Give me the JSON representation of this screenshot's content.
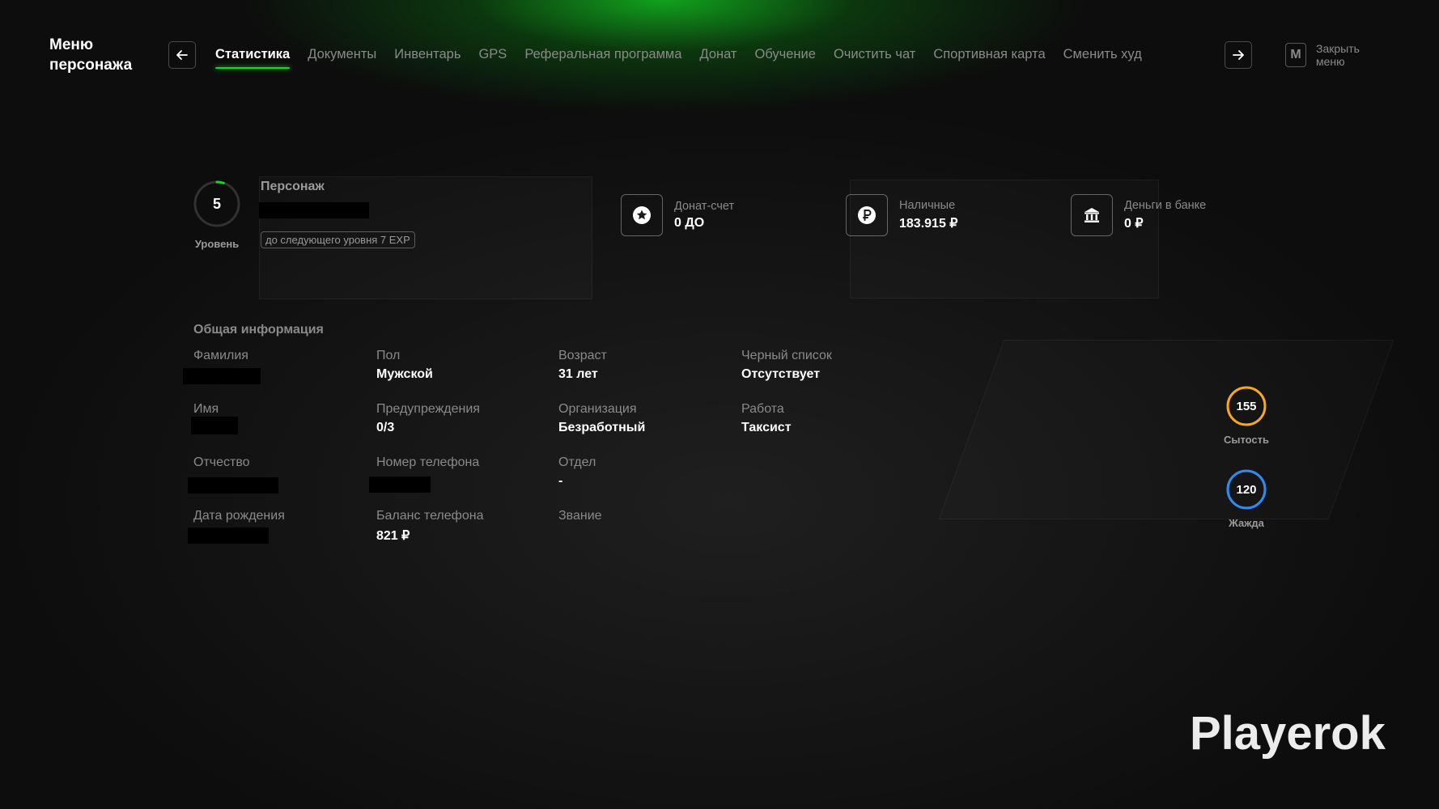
{
  "header": {
    "title_line1": "Меню",
    "title_line2": "персонажа",
    "tabs": [
      {
        "label": "Статистика",
        "active": true
      },
      {
        "label": "Документы"
      },
      {
        "label": "Инвентарь"
      },
      {
        "label": "GPS"
      },
      {
        "label": "Реферальная программа"
      },
      {
        "label": "Донат"
      },
      {
        "label": "Обучение"
      },
      {
        "label": "Очистить чат"
      },
      {
        "label": "Спортивная карта"
      },
      {
        "label": "Сменить худ"
      }
    ],
    "close_key": "M",
    "close_label": "Закрыть меню",
    "accent_color": "#1dd12e"
  },
  "character": {
    "level": "5",
    "level_label": "Уровень",
    "level_progress": 0.05,
    "label": "Персонаж",
    "exp_hint": "до следующего уровня 7 EXP"
  },
  "stats": {
    "donate_label": "Донат-счет",
    "donate_value": "0 ДО",
    "cash_label": "Наличные",
    "cash_value": "183.915 ₽",
    "bank_label": "Деньги в банке",
    "bank_value": "0 ₽",
    "icons": [
      "star-circle-icon",
      "ruble-circle-icon",
      "bank-icon"
    ]
  },
  "info": {
    "title": "Общая информация",
    "surname_label": "Фамилия",
    "name_label": "Имя",
    "patronymic_label": "Отчество",
    "birth_label": "Дата рождения",
    "gender_label": "Пол",
    "gender_value": "Мужской",
    "warnings_label": "Предупреждения",
    "warnings_value": "0/3",
    "phone_label": "Номер телефона",
    "phone_balance_label": "Баланс телефона",
    "phone_balance_value": "821 ₽",
    "age_label": "Возраст",
    "age_value": "31 лет",
    "org_label": "Организация",
    "org_value": "Безработный",
    "dept_label": "Отдел",
    "dept_value": "-",
    "rank_label": "Звание",
    "blacklist_label": "Черный список",
    "blacklist_value": "Отсутствует",
    "job_label": "Работа",
    "job_value": "Таксист"
  },
  "needs": {
    "satiety_value": "155",
    "satiety_label": "Сытость",
    "satiety_color": "#f5a623",
    "thirst_value": "120",
    "thirst_label": "Жажда",
    "thirst_color": "#2d8cf0"
  },
  "watermark": "Playerok"
}
